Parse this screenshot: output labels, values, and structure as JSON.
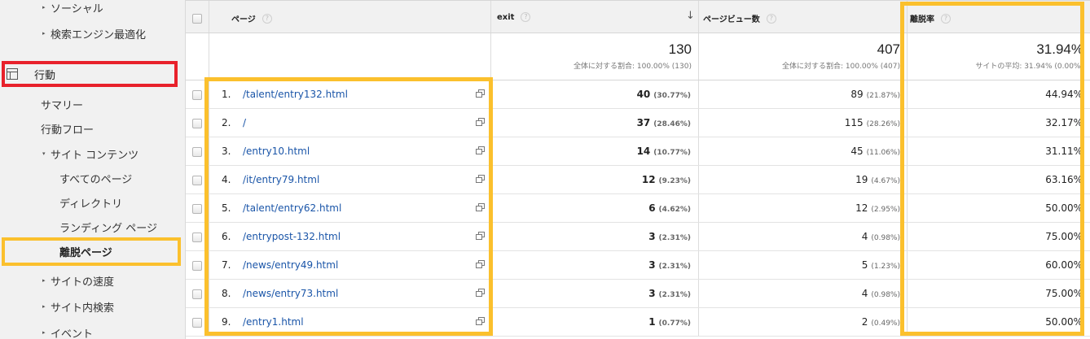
{
  "sidebar": {
    "items": [
      {
        "label": "ソーシャル",
        "arrow": "▸"
      },
      {
        "label": "検索エンジン最適化",
        "arrow": "▸"
      },
      {
        "label": "行動"
      },
      {
        "label": "サマリー"
      },
      {
        "label": "行動フロー"
      },
      {
        "label": "サイト コンテンツ",
        "arrow": "▾"
      },
      {
        "label": "すべてのページ"
      },
      {
        "label": "ディレクトリ"
      },
      {
        "label": "ランディング ページ"
      },
      {
        "label": "離脱ページ"
      },
      {
        "label": "サイトの速度",
        "arrow": "▸"
      },
      {
        "label": "サイト内検索",
        "arrow": "▸"
      },
      {
        "label": "イベント",
        "arrow": "▸"
      }
    ]
  },
  "table": {
    "headers": {
      "page": "ページ",
      "exit": "exit",
      "pageviews": "ページビュー数",
      "bounce": "離脱率",
      "help": "?",
      "sort": "↓"
    },
    "summary": {
      "exit_total": "130",
      "exit_sub": "全体に対する割合: 100.00% (130)",
      "pageviews_total": "407",
      "pageviews_sub": "全体に対する割合: 100.00% (407)",
      "bounce_total": "31.94%",
      "bounce_sub": "サイトの平均: 31.94% (0.00%)"
    },
    "rows": [
      {
        "idx": "1.",
        "page": "/talent/entry132.html",
        "exit": "40",
        "exit_pct": "(30.77%)",
        "pv": "89",
        "pv_pct": "(21.87%)",
        "bounce": "44.94%"
      },
      {
        "idx": "2.",
        "page": "/",
        "exit": "37",
        "exit_pct": "(28.46%)",
        "pv": "115",
        "pv_pct": "(28.26%)",
        "bounce": "32.17%"
      },
      {
        "idx": "3.",
        "page": "/entry10.html",
        "exit": "14",
        "exit_pct": "(10.77%)",
        "pv": "45",
        "pv_pct": "(11.06%)",
        "bounce": "31.11%"
      },
      {
        "idx": "4.",
        "page": "/it/entry79.html",
        "exit": "12",
        "exit_pct": "(9.23%)",
        "pv": "19",
        "pv_pct": "(4.67%)",
        "bounce": "63.16%"
      },
      {
        "idx": "5.",
        "page": "/talent/entry62.html",
        "exit": "6",
        "exit_pct": "(4.62%)",
        "pv": "12",
        "pv_pct": "(2.95%)",
        "bounce": "50.00%"
      },
      {
        "idx": "6.",
        "page": "/entrypost-132.html",
        "exit": "3",
        "exit_pct": "(2.31%)",
        "pv": "4",
        "pv_pct": "(0.98%)",
        "bounce": "75.00%"
      },
      {
        "idx": "7.",
        "page": "/news/entry49.html",
        "exit": "3",
        "exit_pct": "(2.31%)",
        "pv": "5",
        "pv_pct": "(1.23%)",
        "bounce": "60.00%"
      },
      {
        "idx": "8.",
        "page": "/news/entry73.html",
        "exit": "3",
        "exit_pct": "(2.31%)",
        "pv": "4",
        "pv_pct": "(0.98%)",
        "bounce": "75.00%"
      },
      {
        "idx": "9.",
        "page": "/entry1.html",
        "exit": "1",
        "exit_pct": "(0.77%)",
        "pv": "2",
        "pv_pct": "(0.49%)",
        "bounce": "50.00%"
      }
    ]
  },
  "colors": {
    "highlight_red": "#e8212b",
    "highlight_yellow": "#fbc02d",
    "link": "#1a55a8"
  }
}
